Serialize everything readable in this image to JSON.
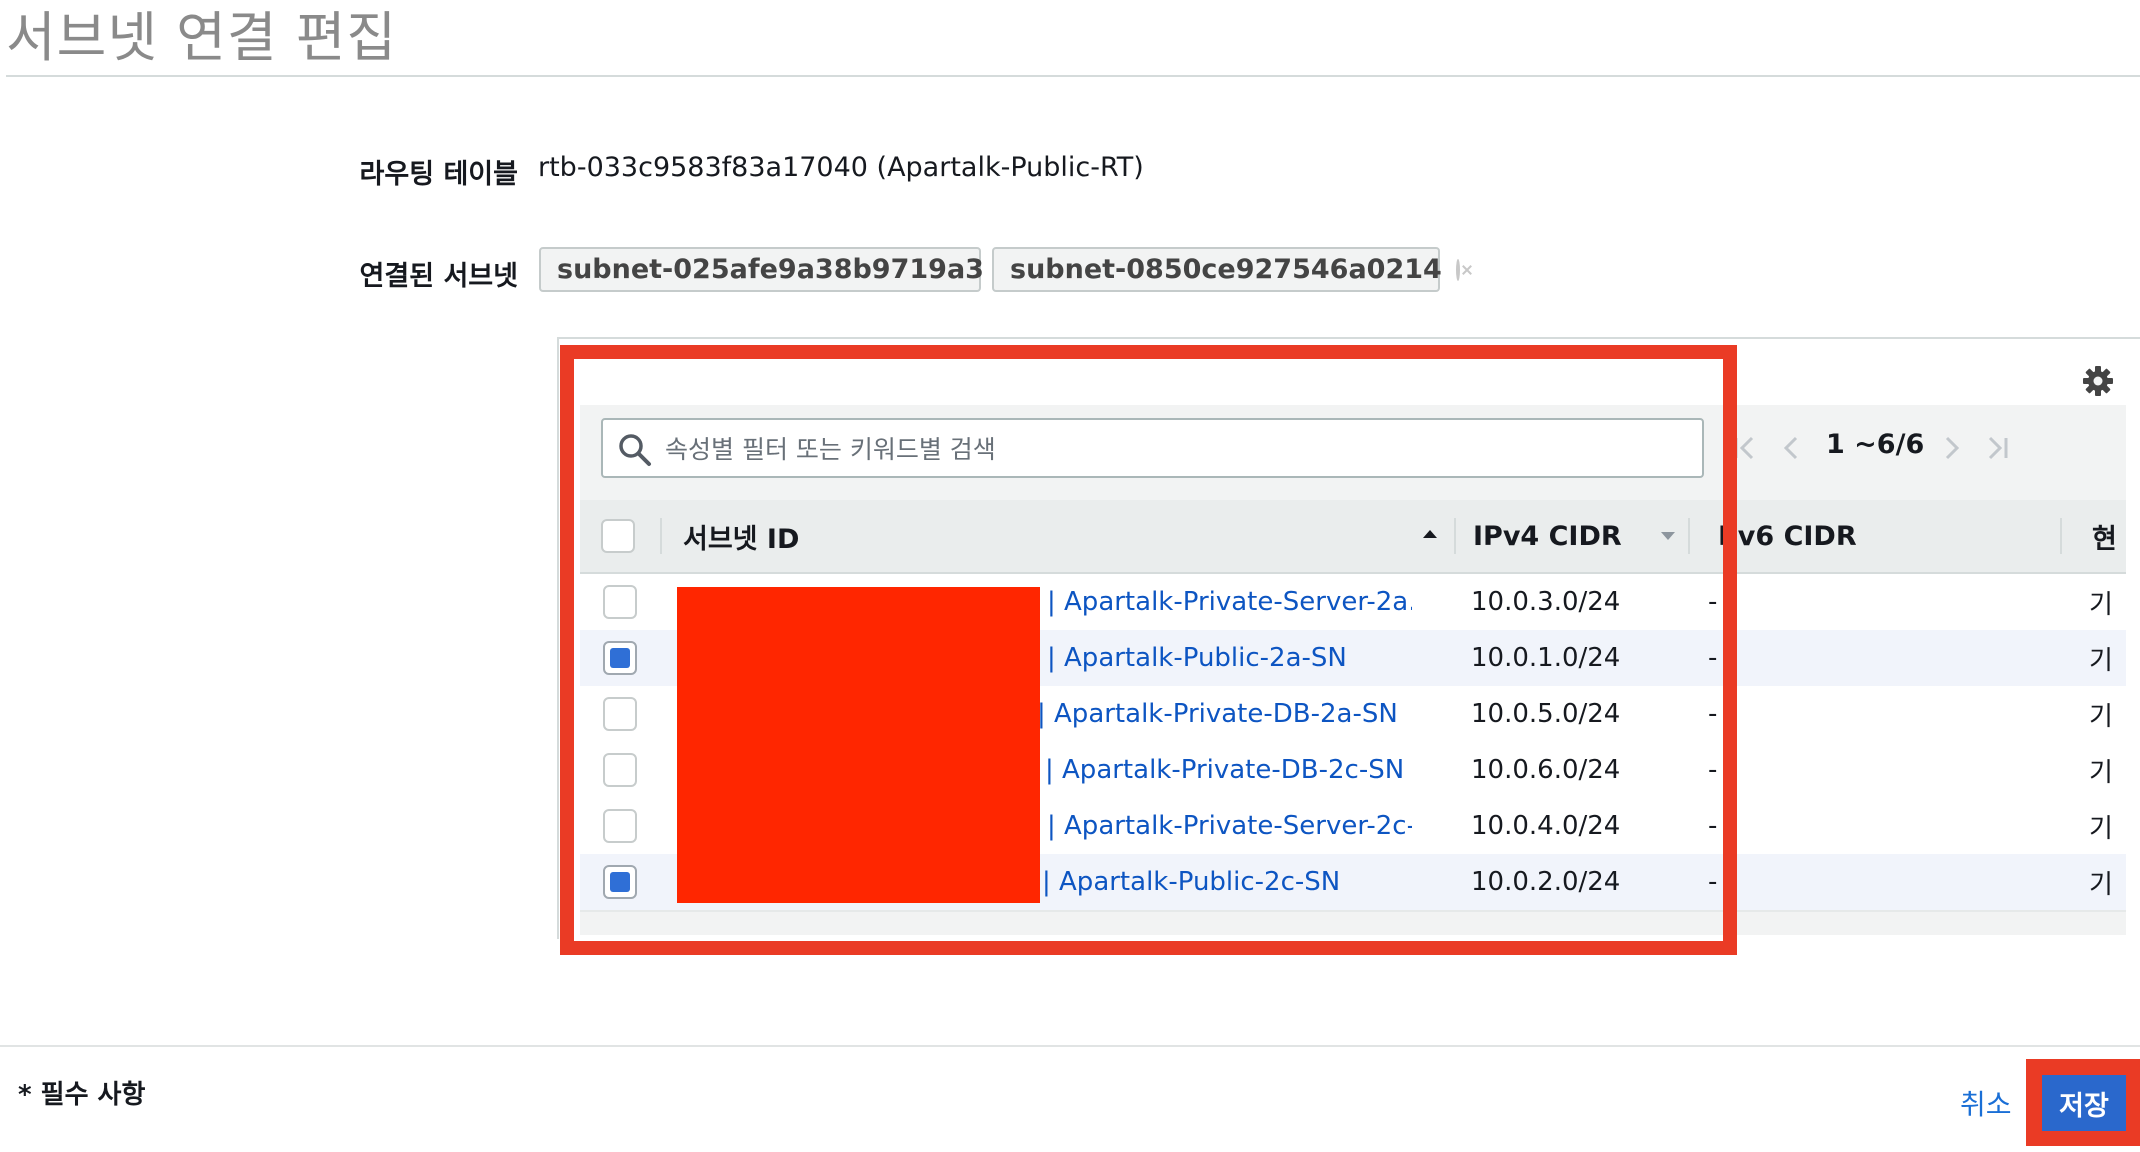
{
  "page_title": "서브넷 연결 편집",
  "route_table": {
    "label": "라우팅 테이블",
    "value": "rtb-033c9583f83a17040 (Apartalk-Public-RT)"
  },
  "associated_subnets": {
    "label": "연결된 서브넷",
    "tokens": [
      "subnet-025afe9a38b9719a3",
      "subnet-0850ce927546a0214"
    ]
  },
  "search": {
    "placeholder": "속성별 필터 또는 키워드별 검색",
    "value": ""
  },
  "pagination": {
    "range_text": "1 ~6/6"
  },
  "table": {
    "columns": {
      "subnet_id": "서브넷 ID",
      "ipv4_cidr": "IPv4 CIDR",
      "ipv6_cidr": "Pv6 CIDR",
      "current": "현"
    },
    "rows": [
      {
        "name": "| Apartalk-Private-Server-2a...",
        "cidr": "10.0.3.0/24",
        "ipv6": "-",
        "state": "기",
        "selected": false
      },
      {
        "name": "| Apartalk-Public-2a-SN",
        "cidr": "10.0.1.0/24",
        "ipv6": "-",
        "state": "기",
        "selected": true
      },
      {
        "name": "| Apartalk-Private-DB-2a-SN",
        "cidr": "10.0.5.0/24",
        "ipv6": "-",
        "state": "기",
        "selected": false
      },
      {
        "name": "| Apartalk-Private-DB-2c-SN",
        "cidr": "10.0.6.0/24",
        "ipv6": "-",
        "state": "기",
        "selected": false
      },
      {
        "name": "| Apartalk-Private-Server-2c-...",
        "cidr": "10.0.4.0/24",
        "ipv6": "-",
        "state": "기",
        "selected": false
      },
      {
        "name": "| Apartalk-Public-2c-SN",
        "cidr": "10.0.2.0/24",
        "ipv6": "-",
        "state": "기",
        "selected": true
      }
    ]
  },
  "footer": {
    "required_note": "* 필수 사항",
    "cancel_label": "취소",
    "save_label": "저장"
  },
  "colors": {
    "highlight": "#ea3b25",
    "redaction": "#ff2600",
    "link": "#0d55c2",
    "primary_button": "#2a68cc"
  }
}
